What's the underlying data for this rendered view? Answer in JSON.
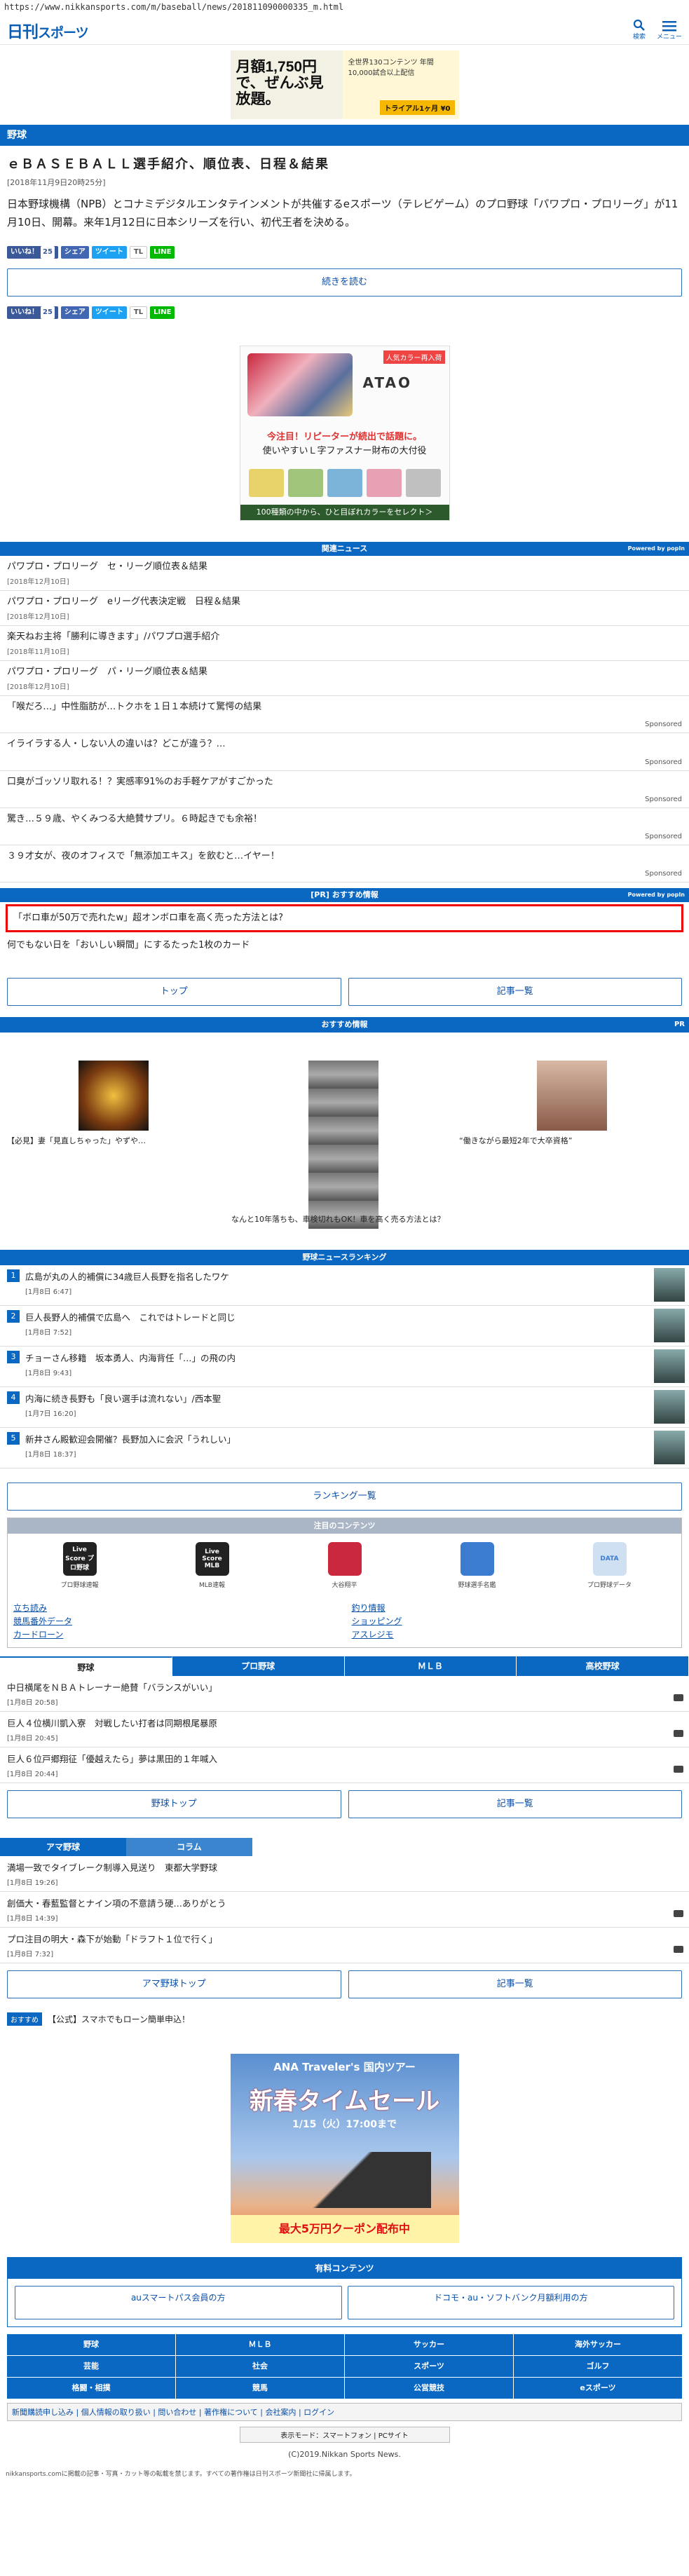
{
  "url": "https://www.nikkansports.com/m/baseball/news/201811090000335_m.html",
  "header": {
    "logo_main": "日刊",
    "logo_sub": "スポーツ",
    "search_label": "検索",
    "menu_label": "メニュー"
  },
  "top_ad": {
    "main": "月額1,750円で、ぜんぶ見放題。",
    "sub": "全世界130コンテンツ 年間10,000試合以上配信",
    "cta": "トライアル1ヶ月 ¥0"
  },
  "section": "野球",
  "article": {
    "title": "ｅＢＡＳＥＢＡＬＬ選手紹介、順位表、日程＆結果",
    "date": "[2018年11月9日20時25分]",
    "lead": "日本野球機構（NPB）とコナミデジタルエンタテインメントが共催するeスポーツ（テレビゲーム）のプロ野球「パワプロ・プロリーグ」が11月10日、開幕。来年1月12日に日本シリーズを行い、初代王者を決める。",
    "more": "続きを読む"
  },
  "share": {
    "like": "いいね！",
    "like_count": "25",
    "share": "シェア",
    "tweet": "ツイート",
    "tl": "TL",
    "line": "LINE"
  },
  "mid_ad": {
    "brand": "ATAO",
    "badge": "人気カラー再入荷",
    "line1": "今注目！リピーターが続出で話題に。",
    "line2": "使いやすいＬ字ファスナー財布の大付役",
    "cta": "100種類の中から、ひと目ぼれカラーをセレクト＞"
  },
  "related": {
    "heading": "関連ニュース",
    "powered": "Powered by popIn",
    "items": [
      {
        "title": "パワプロ・プロリーグ　セ・リーグ順位表＆結果",
        "date": "[2018年12月10日]"
      },
      {
        "title": "パワプロ・プロリーグ　eリーグ代表決定戦　日程＆結果",
        "date": "[2018年12月10日]"
      },
      {
        "title": "楽天ねお主将「勝利に導きます」/パワプロ選手紹介",
        "date": "[2018年11月10日]"
      },
      {
        "title": "パワプロ・プロリーグ　パ・リーグ順位表＆結果",
        "date": "[2018年12月10日]"
      }
    ],
    "sponsored": [
      {
        "title": "「喉だろ…」中性脂肪が…トクホを１日１本続けて驚愕の結果",
        "tag": "Sponsored"
      },
      {
        "title": "イライラする人・しない人の違いは？どこが違う？…",
        "tag": "Sponsored"
      },
      {
        "title": "口臭がゴッソリ取れる！？実感率91%のお手軽ケアがすごかった",
        "tag": "Sponsored"
      },
      {
        "title": "驚き…５９歳、やくみつる大絶賛サプリ。６時起きでも余裕！",
        "tag": "Sponsored"
      },
      {
        "title": "３９才女が、夜のオフィスで「無添加エキス」を飲むと…イヤー！",
        "tag": "Sponsored"
      }
    ]
  },
  "pr": {
    "heading": "[PR] おすすめ情報",
    "powered": "Powered by popIn",
    "items": [
      "「ボロ車が50万で売れたw」超オンボロ車を高く売った方法とは?",
      "何でもない日を「おいしい瞬間」にするたった1枚のカード"
    ]
  },
  "nav_buttons": {
    "top": "トップ",
    "list": "記事一覧"
  },
  "recommend": {
    "heading": "おすすめ情報",
    "pr": "PR",
    "c1": "【必見】妻「見直しちゃった」やずや…",
    "c2": "なんと10年落ちも、車検切れもOK！車を高く売る方法とは？",
    "c3": "“働きながら最短2年で大卒資格”"
  },
  "ranking": {
    "heading": "野球ニュースランキング",
    "items": [
      {
        "no": "1",
        "title": "広島が丸の人的補償に34歳巨人長野を指名したワケ",
        "date": "[1月8日 6:47]"
      },
      {
        "no": "2",
        "title": "巨人長野人的補償で広島へ　これではトレードと同じ",
        "date": "[1月8日 7:52]"
      },
      {
        "no": "3",
        "title": "チョーさん移籍　坂本勇人、内海背任「…」の飛の内",
        "date": "[1月8日 9:43]"
      },
      {
        "no": "4",
        "title": "内海に続き長野も「良い選手は流れない」/西本聖",
        "date": "[1月7日 16:20]"
      },
      {
        "no": "5",
        "title": "新井さん殿歓迎会開催？長野加入に会沢「うれしい」",
        "date": "[1月8日 18:37]"
      }
    ],
    "more": "ランキング一覧"
  },
  "contents": {
    "heading": "注目のコンテンツ",
    "icons": [
      {
        "label": "プロ野球速報",
        "text": "Live Score プロ野球"
      },
      {
        "label": "MLB速報",
        "text": "Live Score MLB"
      },
      {
        "label": "大谷翔平",
        "text": ""
      },
      {
        "label": "野球選手名鑑",
        "text": ""
      },
      {
        "label": "プロ野球データ",
        "text": "DATA"
      }
    ],
    "links": [
      "立ち読み",
      "釣り情報",
      "競馬番外データ",
      "ショッピング",
      "カードローン",
      "アスレジモ"
    ]
  },
  "tabs": [
    "野球",
    "プロ野球",
    "ＭＬＢ",
    "高校野球"
  ],
  "news": [
    {
      "title": "中日横尾をＮＢＡトレーナー絶賛「バランスがいい」",
      "date": "[1月8日 20:58]"
    },
    {
      "title": "巨人４位横川凱入寮　対戦したい打者は同期根尾暴原",
      "date": "[1月8日 20:45]"
    },
    {
      "title": "巨人６位戸郷翔征「優越えたら」夢は黒田的１年喊入",
      "date": "[1月8日 20:44]"
    }
  ],
  "news_buttons": {
    "top": "野球トップ",
    "list": "記事一覧"
  },
  "tabs2": [
    "アマ野球",
    "コラム"
  ],
  "ama": [
    {
      "title": "満場一致でタイブレーク制導入見送り　東都大学野球",
      "date": "[1月8日 19:26]"
    },
    {
      "title": "創価大・春藍監督とナイン項の不意請う硬…ありがとう",
      "date": "[1月8日 14:39]"
    },
    {
      "title": "プロ注目の明大・森下が始動「ドラフト１位で行く」",
      "date": "[1月8日 7:32]"
    }
  ],
  "ama_buttons": {
    "top": "アマ野球トップ",
    "list": "記事一覧"
  },
  "osusume": {
    "label": "おすすめ",
    "text": "【公式】スマホでもローン簡単申込！"
  },
  "ana_ad": {
    "brand": "ANA Traveler's 国内ツアー",
    "title": "新春タイムセール",
    "date": "1/15（火）17:00まで",
    "cta": "最大5万円クーポン配布中"
  },
  "yuryo": {
    "heading": "有料コンテンツ",
    "b1": "auスマートパス会員の方",
    "b2": "ドコモ・au・ソフトバンク月額利用の方"
  },
  "categories": [
    "野球",
    "ＭＬＢ",
    "サッカー",
    "海外サッカー",
    "芸能",
    "社会",
    "スポーツ",
    "ゴルフ",
    "格闘・相撲",
    "競馬",
    "公営競技",
    "eスポーツ"
  ],
  "footer": {
    "links": "新聞購読申し込み | 個人情報の取り扱い | 問い合わせ | 著作権について | 会社案内 | ログイン",
    "mode": "表示モード：スマートフォン | PCサイト",
    "copy": "(C)2019.Nikkan Sports News.",
    "note": "nikkansports.comに掲載の記事・写真・カット等の転載を禁じます。すべての著作権は日刊スポーツ新聞社に帰属します。"
  }
}
